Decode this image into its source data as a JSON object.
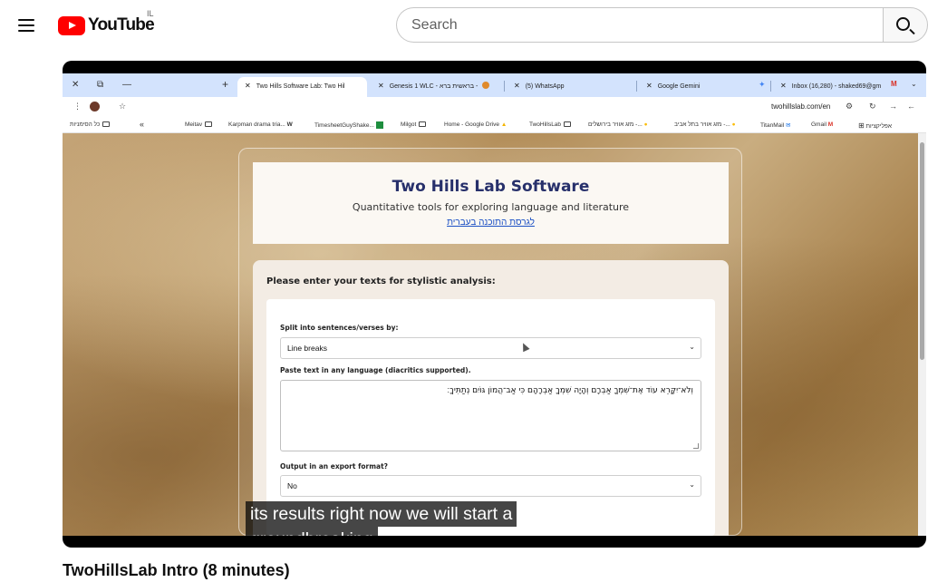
{
  "header": {
    "logo_text": "YouTube",
    "country_code": "IL",
    "search_placeholder": "Search"
  },
  "browser": {
    "window_controls": {
      "close": "✕",
      "restore": "⧉",
      "minimize": "—",
      "new_tab": "+"
    },
    "tabs": [
      {
        "label": "Two Hills Software Lab: Two Hil",
        "active": true
      },
      {
        "label": "Genesis 1 WLC - בראשית ברא -"
      },
      {
        "label": "(5) WhatsApp"
      },
      {
        "label": "Google Gemini"
      },
      {
        "label": "Inbox (16,280) - shaked69@gm"
      }
    ],
    "url": "twohillslab.com/en",
    "bookmarks_right": [
      "אפליקציות",
      "Gmail",
      "TitanMail",
      "מזג אוויר בתל אביב -...",
      "מזג אוויר בירושלים -...",
      "TwoHillsLab",
      "Home - Google Drive",
      "Milgot",
      "TimesheetGuyShake...",
      "Karpman drama tria...",
      "Meitav"
    ],
    "bookmarks_left": [
      "כל הסימניות"
    ],
    "bookmarks_overflow": "«"
  },
  "site": {
    "title": "Two Hills Lab Software",
    "subtitle": "Quantitative tools for exploring language and literature",
    "hebrew_link": "לגרסת התוכנה בעברית",
    "form_heading": "Please enter your texts for stylistic analysis:",
    "split_label": "Split into sentences/verses by:",
    "split_value": "Line breaks",
    "paste_label": "Paste text in any language (diacritics supported).",
    "paste_value": "וְלֹא־יִקָּרֵא עוֹד אֶת־שִׁמְךָ אַבְרָם וְהָיָה שִׁמְךָ אַבְרָהָם כִּי אַב־הֲמוֹן גּוֹיִם נְתַתִּיךָ׃",
    "export_label": "Output in an export format?",
    "export_value": "No"
  },
  "captions": {
    "line1": "its results right now we will start a",
    "line2": "groundbreaking"
  },
  "video_title": "TwoHillsLab Intro (8 minutes)"
}
